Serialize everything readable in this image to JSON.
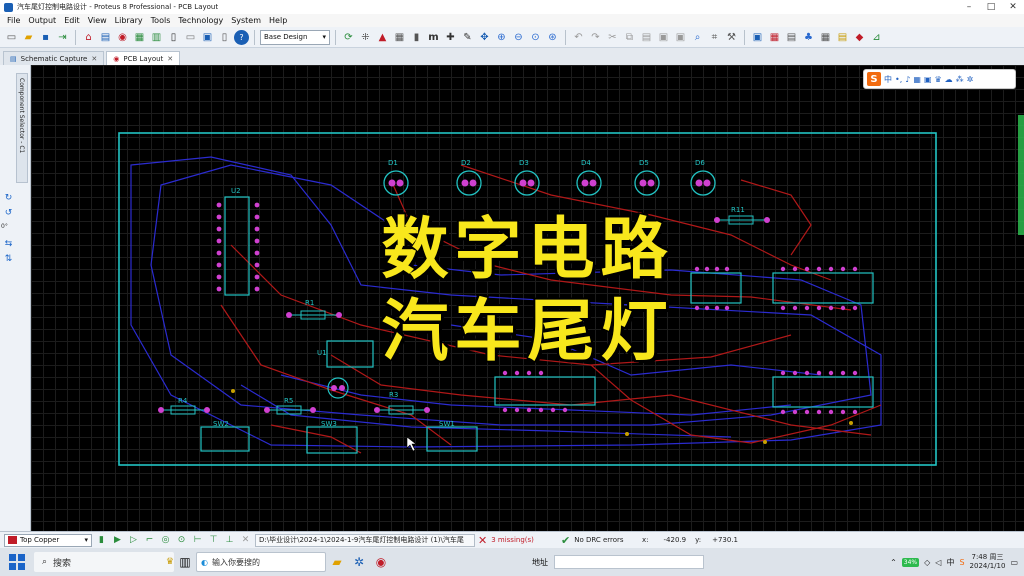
{
  "window": {
    "title": "汽车尾灯控制电路设计 - Proteus 8 Professional - PCB Layout"
  },
  "menu": [
    "File",
    "Output",
    "Edit",
    "View",
    "Library",
    "Tools",
    "Technology",
    "System",
    "Help"
  ],
  "toolbar": {
    "design_combo": "Base Design"
  },
  "tabs": [
    {
      "label": "Schematic Capture",
      "active": false
    },
    {
      "label": "PCB Layout",
      "active": true
    }
  ],
  "left_panel": {
    "tab_label": "Component Selector - C1",
    "rotation_value": "0°"
  },
  "ime": {
    "logo": "S",
    "mode": "中",
    "punct": "•,"
  },
  "overlay": {
    "line1": "数字电路",
    "line2": "汽车尾灯"
  },
  "pcb": {
    "leds": [
      "D1",
      "D2",
      "D3",
      "D4",
      "D5",
      "D6"
    ],
    "resistors": [
      "R11",
      "R1",
      "R4",
      "R5",
      "R3"
    ],
    "ics": [
      "U2",
      "U1"
    ],
    "switches": [
      "SW2",
      "SW3",
      "SW1"
    ],
    "colors": {
      "outline": "#22c3c3",
      "pads": "#d040d0",
      "track_top": "#b01818",
      "track_bottom": "#2b2bd0"
    }
  },
  "status": {
    "layer": "Top Copper",
    "layer_color": "#c01c28",
    "path": "D:\\毕业设计\\2024-1\\2024-1-9汽车尾灯控制电路设计 (1)\\汽车尾",
    "missing": "3 missing(s)",
    "drc": "No DRC errors",
    "x_label": "x:",
    "x_value": "-420.9",
    "y_label": "y:",
    "y_value": "+730.1"
  },
  "taskbar": {
    "search": "搜索",
    "app_label": "输入你要搜的",
    "address_label": "地址",
    "battery": "34%",
    "time": "7:48 周三",
    "date": "2024/1/10"
  }
}
